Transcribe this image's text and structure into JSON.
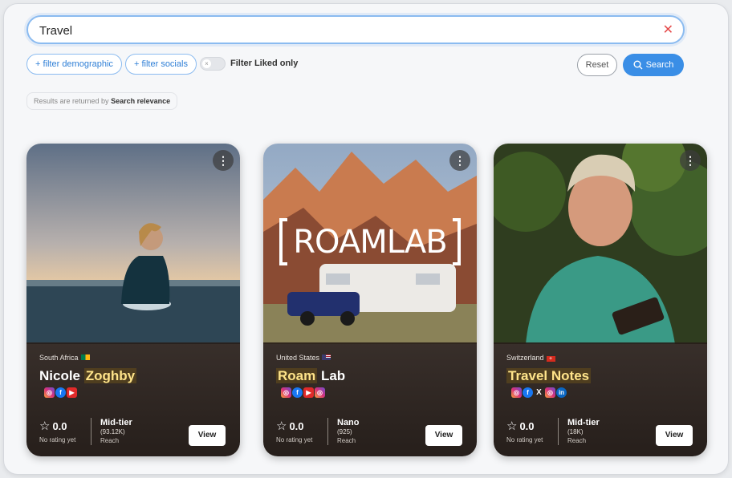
{
  "search": {
    "value": "Travel"
  },
  "filters": {
    "demographic_label": "+ filter demographic",
    "socials_label": "+ filter socials",
    "liked_label": "Filter Liked only",
    "toggle_knob": "×"
  },
  "actions": {
    "reset_label": "Reset",
    "search_label": "Search"
  },
  "relevance": {
    "prefix": "Results are returned by",
    "value": "Search relevance"
  },
  "colors": {
    "accent": "#3a8ee6",
    "highlight": "#ffe48a"
  },
  "cards": [
    {
      "country": "South Africa",
      "name_highlight": "",
      "name_first": "Nicole",
      "name_rest": "Zoghby",
      "socials": [
        "instagram-icon",
        "facebook-icon",
        "youtube-icon"
      ],
      "rating": "0.0",
      "rating_sub": "No rating yet",
      "tier": "Mid-tier",
      "reach_count": "(93.12K)",
      "reach_label": "Reach",
      "view_label": "View"
    },
    {
      "country": "United States",
      "name_first": "Roam",
      "name_rest": "Lab",
      "logo_text": "ROAMLAB",
      "socials": [
        "instagram-icon",
        "facebook-icon",
        "youtube-icon",
        "instagram-alt-icon"
      ],
      "rating": "0.0",
      "rating_sub": "No rating yet",
      "tier": "Nano",
      "reach_count": "(925)",
      "reach_label": "Reach",
      "view_label": "View"
    },
    {
      "country": "Switzerland",
      "name_first": "Travel Notes",
      "socials": [
        "instagram-icon",
        "facebook-icon",
        "x-icon",
        "instagram-alt-icon",
        "linkedin-icon"
      ],
      "rating": "0.0",
      "rating_sub": "No rating yet",
      "tier": "Mid-tier",
      "reach_count": "(18K)",
      "reach_label": "Reach",
      "view_label": "View"
    }
  ],
  "menu_glyph": "⋮",
  "star_glyph": "☆"
}
